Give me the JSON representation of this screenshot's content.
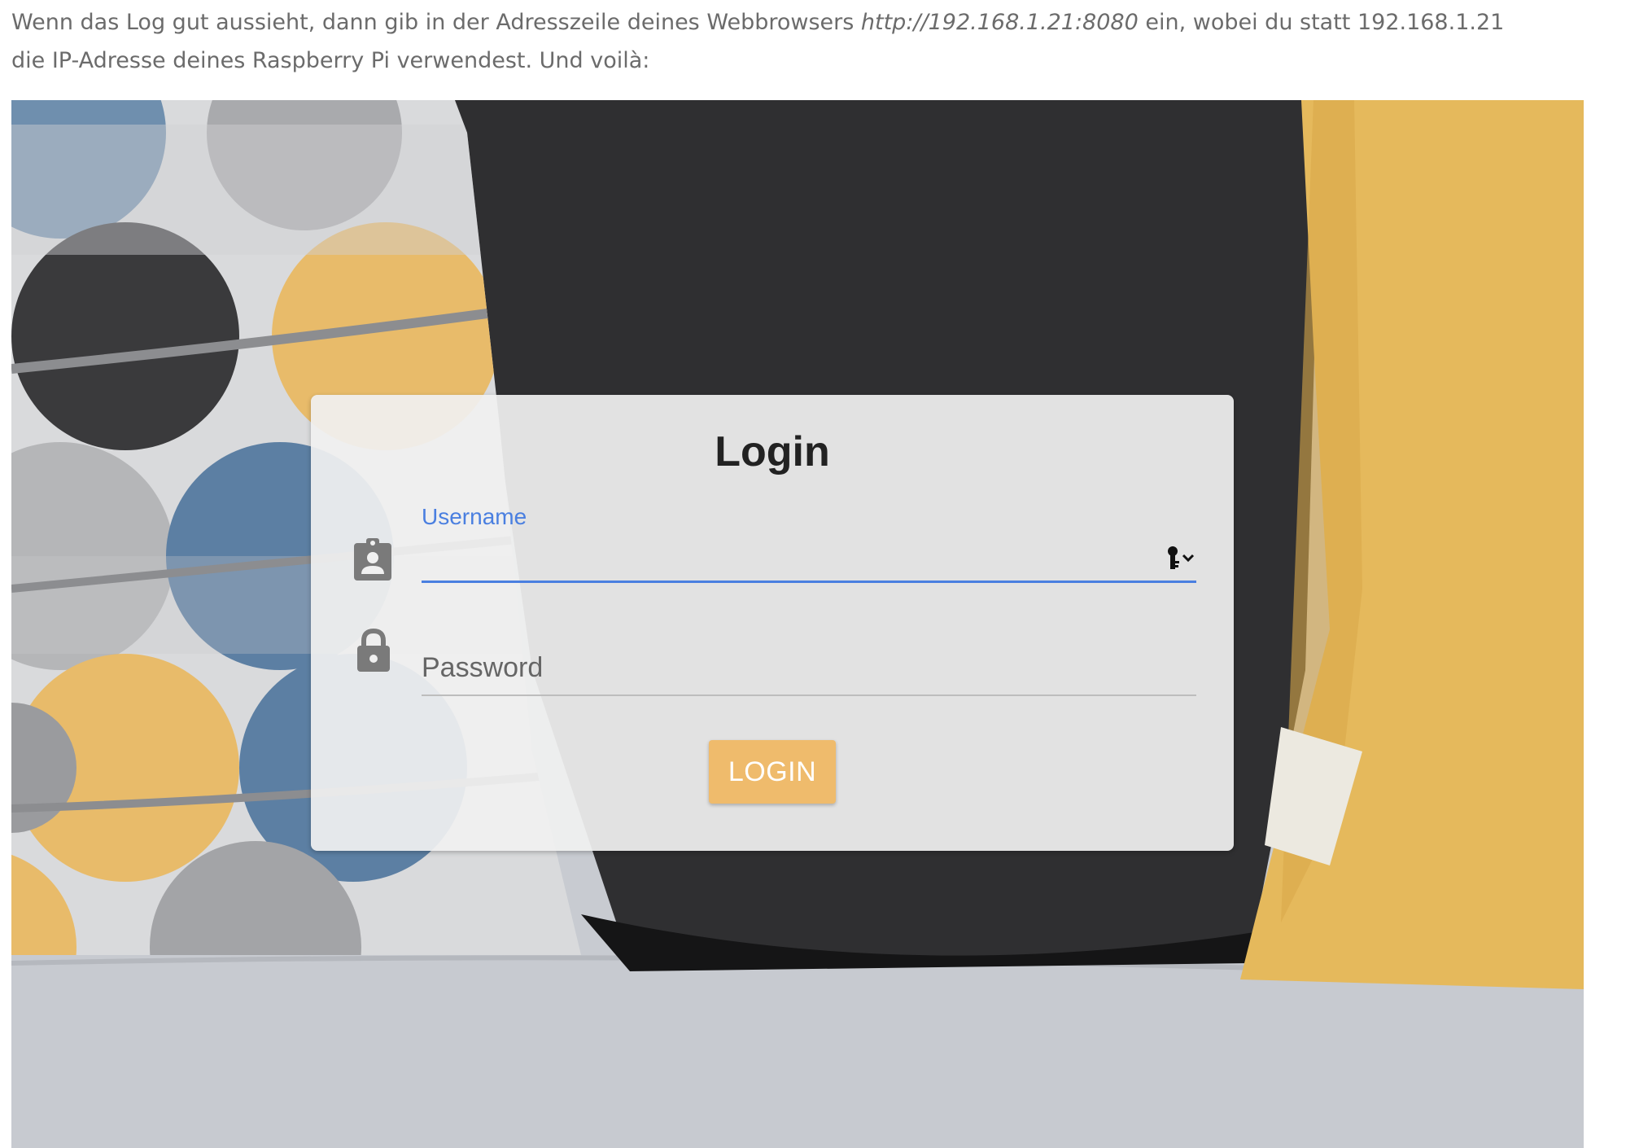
{
  "intro": {
    "text_before": "Wenn das Log gut aussieht, dann gib in der Adresszeile deines Webbrowsers ",
    "url": "http://192.168.1.21:8080",
    "text_after": " ein, wobei du statt 192.168.1.21 die IP-Adresse deines Raspberry Pi verwendest. Und voilà:"
  },
  "login": {
    "title": "Login",
    "username_label": "Username",
    "username_value": "",
    "password_placeholder": "Password",
    "button_label": "LOGIN"
  },
  "icons": {
    "username": "contact-badge-icon",
    "password": "lock-icon",
    "autofill": "key-dropdown-icon"
  },
  "colors": {
    "accent_blue": "#4a7fe0",
    "button_orange": "#efbb6c",
    "text_gray": "#6b6b6b"
  }
}
